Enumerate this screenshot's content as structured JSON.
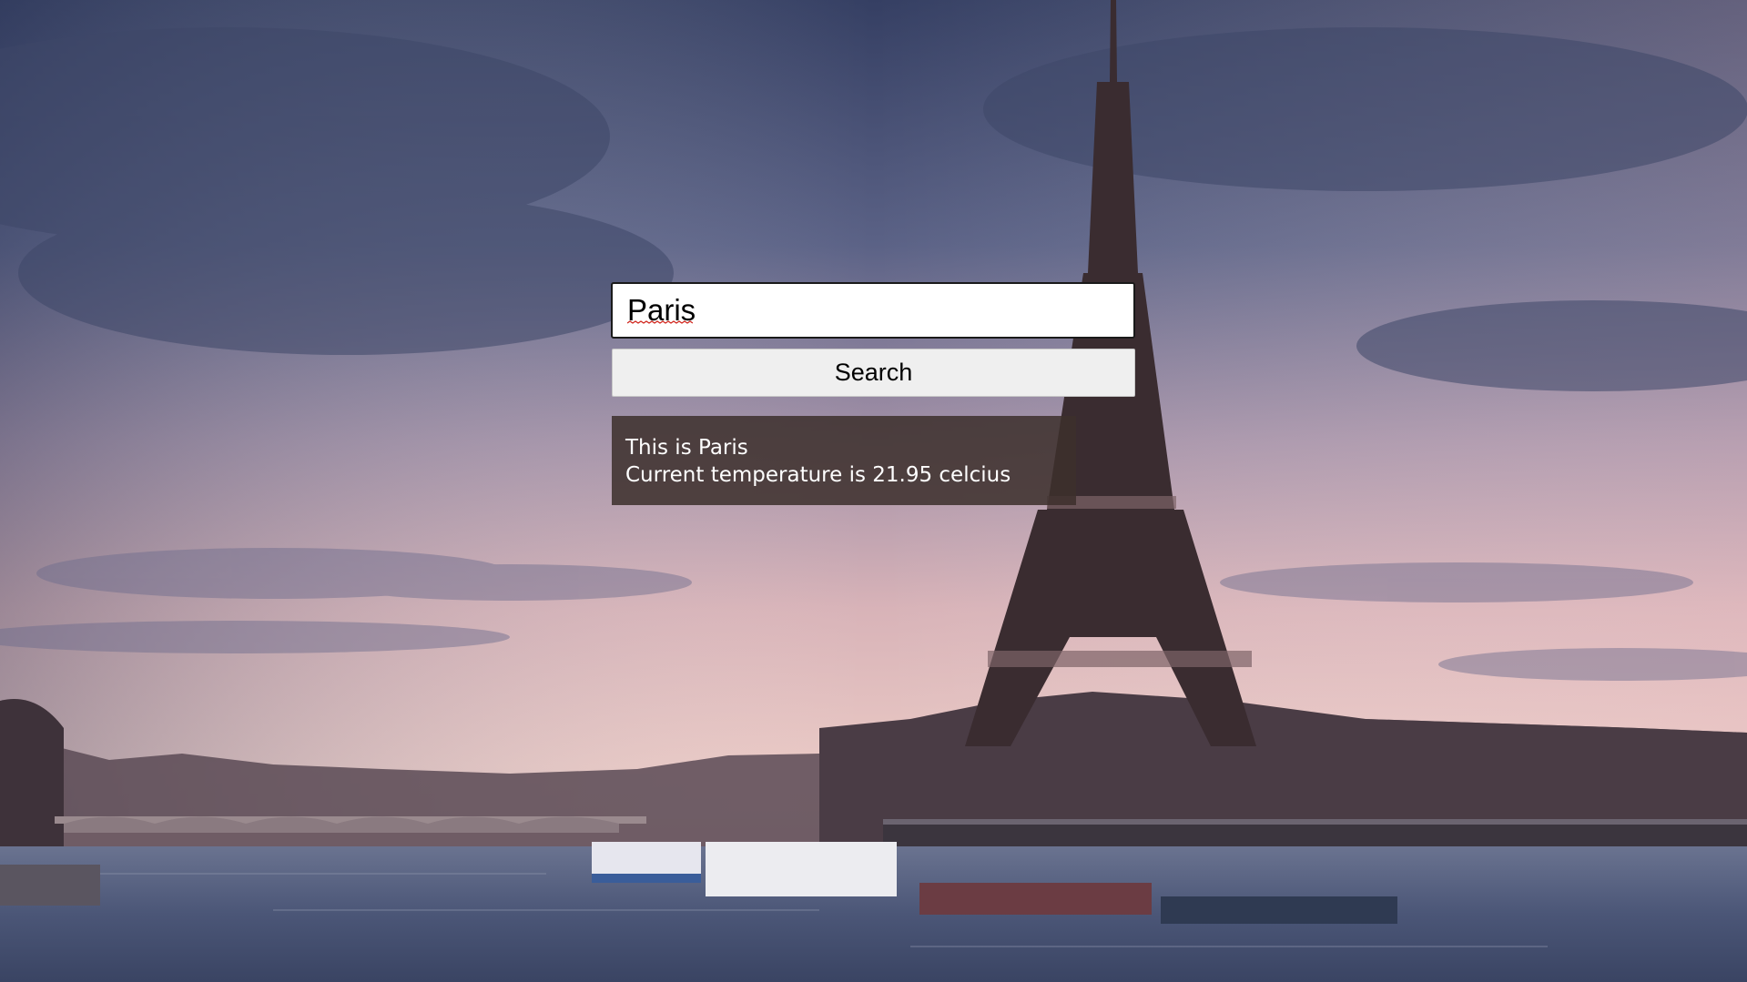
{
  "search": {
    "value": "Paris",
    "button_label": "Search"
  },
  "result": {
    "city_line": "This is Paris",
    "temperature_line": "Current temperature is 21.95 celcius"
  },
  "colors": {
    "panel_background": "#3c302c",
    "panel_text": "#ffffff",
    "button_background": "#efefef",
    "sky_top": "#3f4a6e",
    "sky_horizon": "#e7c2c3",
    "river": "#4d5a78"
  },
  "background": {
    "scene": "eiffel-tower-seine-dusk"
  }
}
